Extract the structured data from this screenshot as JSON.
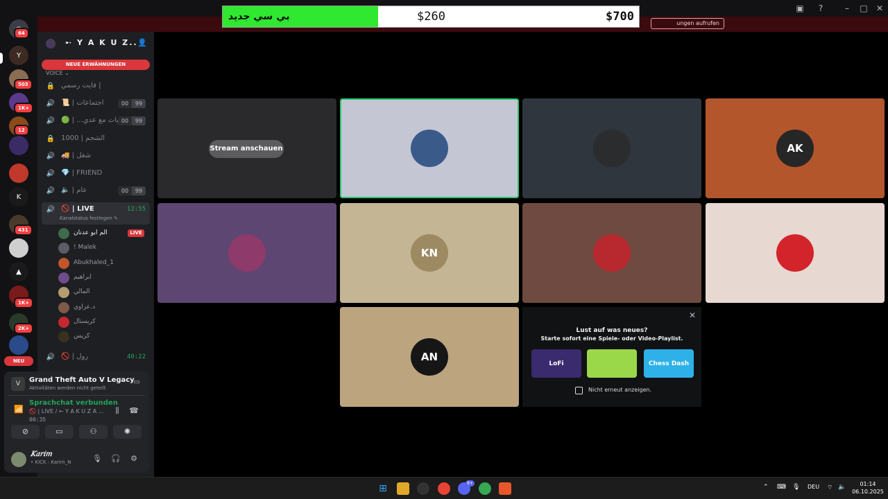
{
  "window": {
    "inbox_icon": "inbox-icon",
    "help_icon": "question-icon",
    "minimize": "–",
    "maximize": "□",
    "close": "✕"
  },
  "notice": {
    "button": "ungen aufrufen",
    "close": "✕"
  },
  "price_overlay": {
    "new_label": "بي سي جديد",
    "old_price": "$260",
    "current_price": "$700"
  },
  "rail": {
    "badges": [
      "64",
      "503",
      "1K+",
      "12",
      "431",
      "1K+",
      "2K+"
    ],
    "new_label": "NEU"
  },
  "guild": {
    "name": "➸ Y A K U Z..",
    "mentions_banner": "NEUE ERWÄHNUNGEN",
    "category": "VOICE"
  },
  "channels": [
    {
      "icon": "lock-icon",
      "glyph": "🔒",
      "label": "فايت رسمي |",
      "limit": null
    },
    {
      "icon": "speaker-icon",
      "glyph": "🔊",
      "label": "📜 | اجتماعات",
      "limit": [
        "00",
        "99"
      ]
    },
    {
      "icon": "speaker-icon",
      "glyph": "🔊",
      "label": "🟢 | ...بات مع عدي",
      "limit": [
        "00",
        "99"
      ]
    },
    {
      "icon": "lock-icon",
      "glyph": "🔒",
      "label": "الشجم | 1000",
      "limit": null
    },
    {
      "icon": "speaker-icon",
      "glyph": "🔊",
      "label": "🚚 | شغل",
      "limit": null
    },
    {
      "icon": "speaker-icon",
      "glyph": "🔊",
      "label": "💎 | FRIEND",
      "limit": null
    },
    {
      "icon": "speaker-icon",
      "glyph": "🔊",
      "label": "🔈 | عام",
      "limit": [
        "00",
        "99"
      ]
    }
  ],
  "live_channel": {
    "label": "🚫 | LIVE",
    "time": "12:55",
    "status": "Kanalstatus festlegen ✎"
  },
  "voice_users": [
    {
      "name": "الم ابو عدنان",
      "live": "LIVE",
      "color": "#3e6b4a"
    },
    {
      "name": "! Malek",
      "live": null,
      "color": "#5a5d66"
    },
    {
      "name": "Abukhaled_1",
      "live": null,
      "color": "#c0562a"
    },
    {
      "name": "ابراهيم",
      "live": null,
      "color": "#6f4c8a"
    },
    {
      "name": "المالي",
      "live": null,
      "color": "#b59c72"
    },
    {
      "name": "د.عزاوي",
      "live": null,
      "color": "#7d5a4a"
    },
    {
      "name": "كريستال",
      "live": null,
      "color": "#c4282e"
    },
    {
      "name": "كريس",
      "live": null,
      "color": "#3a3020"
    }
  ],
  "next_channel": {
    "label": "🚫 | رول",
    "time": "40:22"
  },
  "activity": {
    "title": "Grand Theft Auto V Legacy",
    "subtitle": "Aktivitäten werden nicht geteilt"
  },
  "voice": {
    "status": "Sprachchat verbunden",
    "channel": "🚫 | LIVE / ➸ Y A K U Z A ...",
    "time": "00:35",
    "controls": [
      "camera-off-icon",
      "screenshare-icon",
      "gamepad-icon",
      "soundboard-icon"
    ]
  },
  "me": {
    "name": "𝐾𝑎𝑟𝑖𝑚",
    "status": "• KICK : Karim_N"
  },
  "tiles": [
    {
      "kind": "stream",
      "button": "Stream anschauen",
      "bg": "#2a2a2c"
    },
    {
      "kind": "user",
      "bg": "#c4c6d4",
      "avatar": "#3a5a8a",
      "initials": "",
      "speaking": true
    },
    {
      "kind": "user",
      "bg": "#30363d",
      "avatar": "#2a2c2e",
      "initials": ""
    },
    {
      "kind": "user",
      "bg": "#b4562b",
      "avatar": "#262626",
      "initials": "AK"
    },
    {
      "kind": "user",
      "bg": "#5d4672",
      "avatar": "#8e3a6a",
      "initials": ""
    },
    {
      "kind": "user",
      "bg": "#c4b594",
      "avatar": "#9d8a62",
      "initials": "KN"
    },
    {
      "kind": "user",
      "bg": "#6e4a40",
      "avatar": "#b8292f",
      "initials": ""
    },
    {
      "kind": "user",
      "bg": "#e7d8d1",
      "avatar": "#d3242b",
      "initials": ""
    },
    {
      "kind": "user",
      "bg": "#bba47e",
      "avatar": "#161616",
      "initials": "AN"
    }
  ],
  "promo": {
    "title": "Lust auf was neues?",
    "subtitle": "Starte sofort eine Spiele- oder Video-Playlist.",
    "thumbs": [
      {
        "label": "LoFi",
        "bg": "#3a2a6e"
      },
      {
        "label": "",
        "bg": "#9ad84a"
      },
      {
        "label": "Chess Dash",
        "bg": "#2db1e8"
      }
    ],
    "checkbox": "Nicht erneut anzeigen.",
    "close": "✕"
  },
  "taskbar": {
    "lang": "DEU",
    "time": "01:14",
    "date": "06.10.2025",
    "discord_badge": "9+"
  }
}
